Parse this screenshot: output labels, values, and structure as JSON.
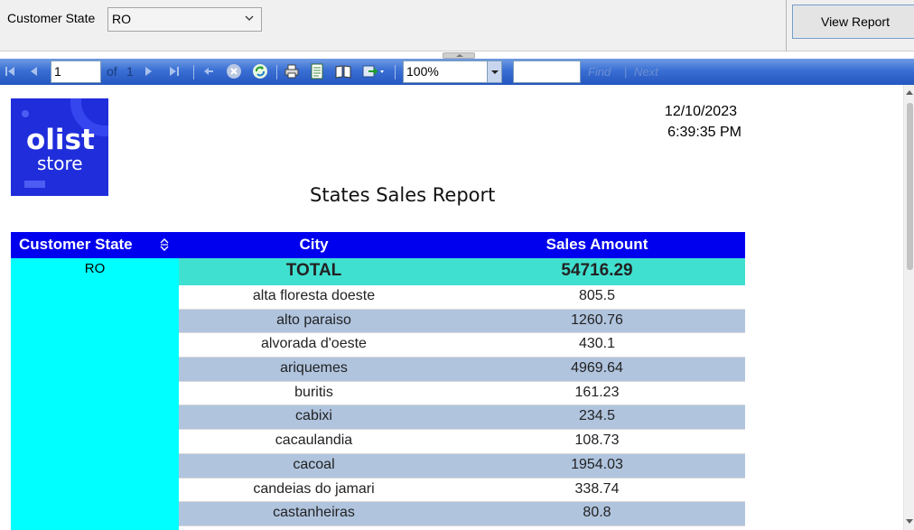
{
  "parameters": {
    "label": "Customer State",
    "selected_value": "RO",
    "view_report_label": "View Report"
  },
  "toolbar": {
    "current_page": "1",
    "of_label": "of",
    "total_pages": "1",
    "zoom": "100%",
    "find_label": "Find",
    "separator": "|",
    "next_label": "Next",
    "icons": [
      "first-page-icon",
      "previous-page-icon",
      "next-page-icon",
      "last-page-icon",
      "back-icon",
      "stop-icon",
      "refresh-icon",
      "print-icon",
      "page-setup-icon",
      "print-layout-icon",
      "export-icon"
    ]
  },
  "report": {
    "logo": {
      "line1": "olist",
      "line2": "store",
      "color": "#1f2ddb"
    },
    "date": "12/10/2023",
    "time": "6:39:35 PM",
    "title": "States Sales Report",
    "columns": [
      "Customer State",
      "City",
      "Sales Amount"
    ],
    "state": "RO",
    "total_label": "TOTAL",
    "total_value": "54716.29",
    "rows": [
      {
        "city": "alta floresta doeste",
        "amount": "805.5"
      },
      {
        "city": "alto paraiso",
        "amount": "1260.76"
      },
      {
        "city": "alvorada d'oeste",
        "amount": "430.1"
      },
      {
        "city": "ariquemes",
        "amount": "4969.64"
      },
      {
        "city": "buritis",
        "amount": "161.23"
      },
      {
        "city": "cabixi",
        "amount": "234.5"
      },
      {
        "city": "cacaulandia",
        "amount": "108.73"
      },
      {
        "city": "cacoal",
        "amount": "1954.03"
      },
      {
        "city": "candeias do jamari",
        "amount": "338.74"
      },
      {
        "city": "castanheiras",
        "amount": "80.8"
      }
    ],
    "colors": {
      "header_bg": "#0000ee",
      "state_bg": "#00ffff",
      "total_bg": "#40e0d0",
      "alt_row_bg": "#b0c4de"
    }
  }
}
